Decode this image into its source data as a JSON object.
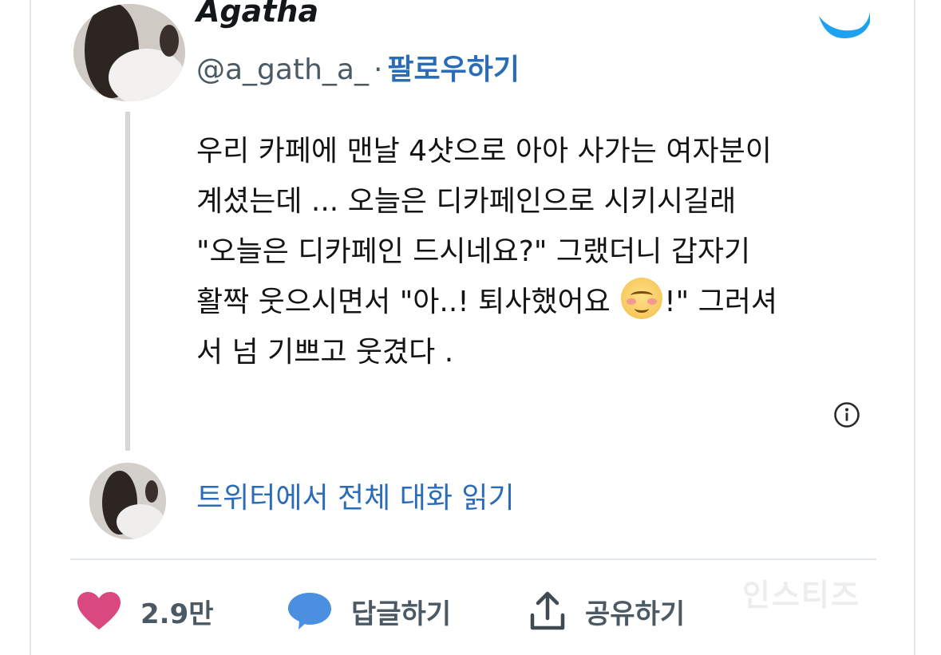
{
  "tweet": {
    "author_name": "Agatha",
    "handle": "@a_gath_a_",
    "separator": "·",
    "follow_label": "팔로우하기",
    "lines": [
      "우리 카페에 맨날 4샷으로 아아 사가는 여자분이",
      "계셨는데 ... 오늘은 디카페인으로 시키시길래",
      "\"오늘은 디카페인 드시네요?\" 그랬더니 갑자기"
    ],
    "line4_before": "활짝 웃으시면서 \"아..! 퇴사했어요",
    "line4_after": "!\" 그러셔",
    "line5": "서 넘 기쁘고 웃겼다 .",
    "emoji": "smiling-face-with-blush"
  },
  "read_more_label": "트위터에서 전체 대화 읽기",
  "actions": {
    "likes_count": "2.9만",
    "reply_label": "답글하기",
    "share_label": "공유하기"
  },
  "watermark": "인스티즈",
  "colors": {
    "link_blue": "#2b6cb8",
    "twitter_blue": "#1da1f2",
    "heart_pink": "#e0245e",
    "text": "#141414",
    "muted": "#4a5964"
  }
}
